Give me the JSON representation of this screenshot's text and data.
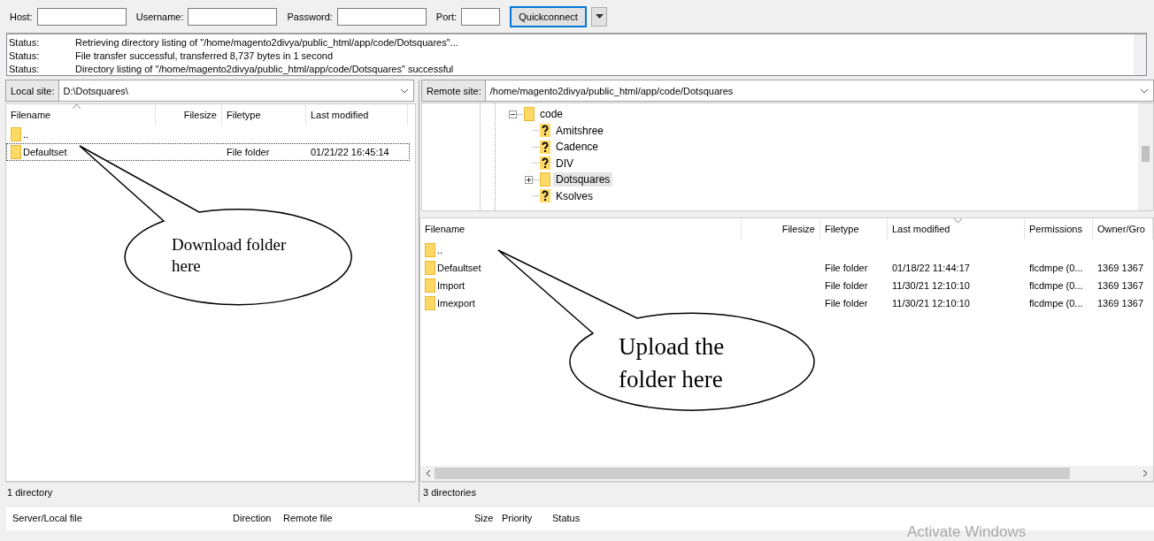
{
  "toolbar": {
    "fields": [
      {
        "label": "Host:"
      },
      {
        "label": "Username:"
      },
      {
        "label": "Password:"
      },
      {
        "label": "Port:"
      }
    ],
    "button": "Quickconnect"
  },
  "message_log": [
    {
      "label": "Status:",
      "message": "Retrieving directory listing of \"/home/magento2divya/public_html/app/code/Dotsquares\"..."
    },
    {
      "label": "Status:",
      "message": "File transfer successful, transferred 8,737 bytes in 1 second"
    },
    {
      "label": "Status:",
      "message": "Directory listing of \"/home/magento2divya/public_html/app/code/Dotsquares\" successful"
    }
  ],
  "local": {
    "site_label": "Local site:",
    "path": "D:\\Dotsquares\\",
    "columns": [
      {
        "label": "Filename",
        "sorted": true
      },
      {
        "label": "Filesize",
        "sorted": false
      },
      {
        "label": "Filetype",
        "sorted": false
      },
      {
        "label": "Last modified",
        "sorted": false
      }
    ],
    "rows": [
      {
        "name": "..",
        "focused": false
      },
      {
        "name": "Defaultset",
        "filetype": "File folder",
        "last_modified": "01/21/22 16:45:14",
        "focused": true
      }
    ],
    "status": "1 directory"
  },
  "remote": {
    "site_label": "Remote site:",
    "path": "/home/magento2divya/public_html/app/code/Dotsquares",
    "tree": [
      {
        "name": "code",
        "kind": "folder",
        "expanded": true,
        "selected": false,
        "children": [
          {
            "name": "Amitshree",
            "kind": "unknown",
            "selected": false
          },
          {
            "name": "Cadence",
            "kind": "unknown",
            "selected": false
          },
          {
            "name": "DIV",
            "kind": "unknown",
            "selected": false
          },
          {
            "name": "Dotsquares",
            "kind": "folder",
            "expanded": false,
            "selected": true
          },
          {
            "name": "Ksolves",
            "kind": "unknown",
            "selected": false
          }
        ]
      }
    ],
    "columns": [
      {
        "label": "Filename",
        "sorted": false
      },
      {
        "label": "Filesize",
        "sorted": false
      },
      {
        "label": "Filetype",
        "sorted": false
      },
      {
        "label": "Last modified",
        "sorted": true
      },
      {
        "label": "Permissions",
        "sorted": false
      },
      {
        "label": "Owner/Gro",
        "sorted": false
      }
    ],
    "rows": [
      {
        "name": ".."
      },
      {
        "name": "Defaultset",
        "filetype": "File folder",
        "last_modified": "01/18/22 11:44:17",
        "permissions": "flcdmpe (0...",
        "column_6": "1369 1367"
      },
      {
        "name": "Import",
        "filetype": "File folder",
        "last_modified": "11/30/21 12:10:10",
        "permissions": "flcdmpe (0...",
        "column_6": "1369 1367"
      },
      {
        "name": "Imexport",
        "filetype": "File folder",
        "last_modified": "11/30/21 12:10:10",
        "permissions": "flcdmpe (0...",
        "column_6": "1369 1367"
      }
    ],
    "status": "3 directories"
  },
  "queue": {
    "columns": [
      "Server/Local file",
      "Direction",
      "Remote file",
      "Size",
      "Priority",
      "Status"
    ]
  },
  "watermark": "Activate Windows",
  "callouts": [
    {
      "text": "Download folder here"
    },
    {
      "text": "Upload the folder here"
    }
  ]
}
